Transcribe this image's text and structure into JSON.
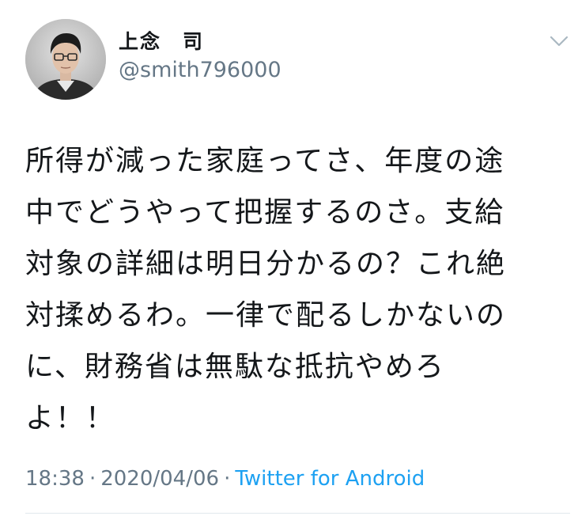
{
  "author": {
    "display_name": "上念　司",
    "handle": "@smith796000"
  },
  "tweet": {
    "lines": [
      "所得が減った家庭ってさ、年度の途",
      "中でどうやって把握するのさ。支給",
      "対象の詳細は明日分かるの？これ絶",
      "対揉めるわ。一律で配るしかないの",
      "に、財務省は無駄な抵抗やめろ",
      "よ！！"
    ]
  },
  "meta": {
    "time": "18:38",
    "separator": "·",
    "date": "2020/04/06",
    "source": "Twitter for Android"
  },
  "icons": {
    "menu": "chevron-down-icon",
    "avatar": "profile-photo"
  },
  "colors": {
    "text": "#14171a",
    "secondary": "#657786",
    "link": "#1da1f2"
  }
}
